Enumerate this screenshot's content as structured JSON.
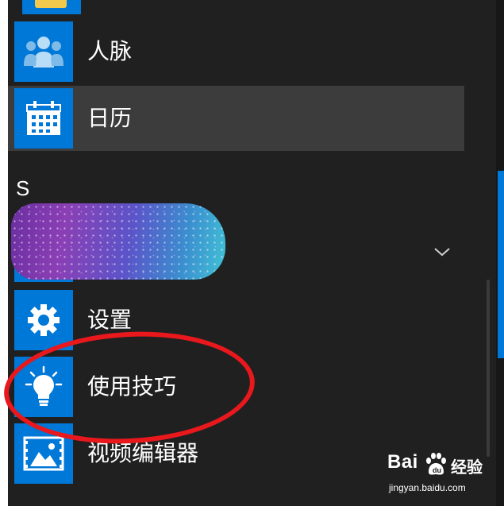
{
  "start_menu": {
    "items": [
      {
        "label": "人脉",
        "icon": "people-icon"
      },
      {
        "label": "日历",
        "icon": "calendar-icon",
        "highlighted": true
      },
      {
        "label": "设置",
        "icon": "gear-icon"
      },
      {
        "label": "使用技巧",
        "icon": "lightbulb-icon"
      },
      {
        "label": "视频编辑器",
        "icon": "video-editor-icon"
      }
    ],
    "section_letter": "S",
    "redacted_item_icon": "folder-icon",
    "expand_icon": "chevron-down-icon"
  },
  "annotation": {
    "shape": "oval",
    "color": "#e8181c"
  },
  "watermark": {
    "brand_left": "Bai",
    "brand_right": "经验",
    "url": "jingyan.baidu.com"
  },
  "colors": {
    "tile": "#0078d7",
    "background": "#202020",
    "highlight": "#3c3c3c",
    "text": "#ffffff"
  }
}
